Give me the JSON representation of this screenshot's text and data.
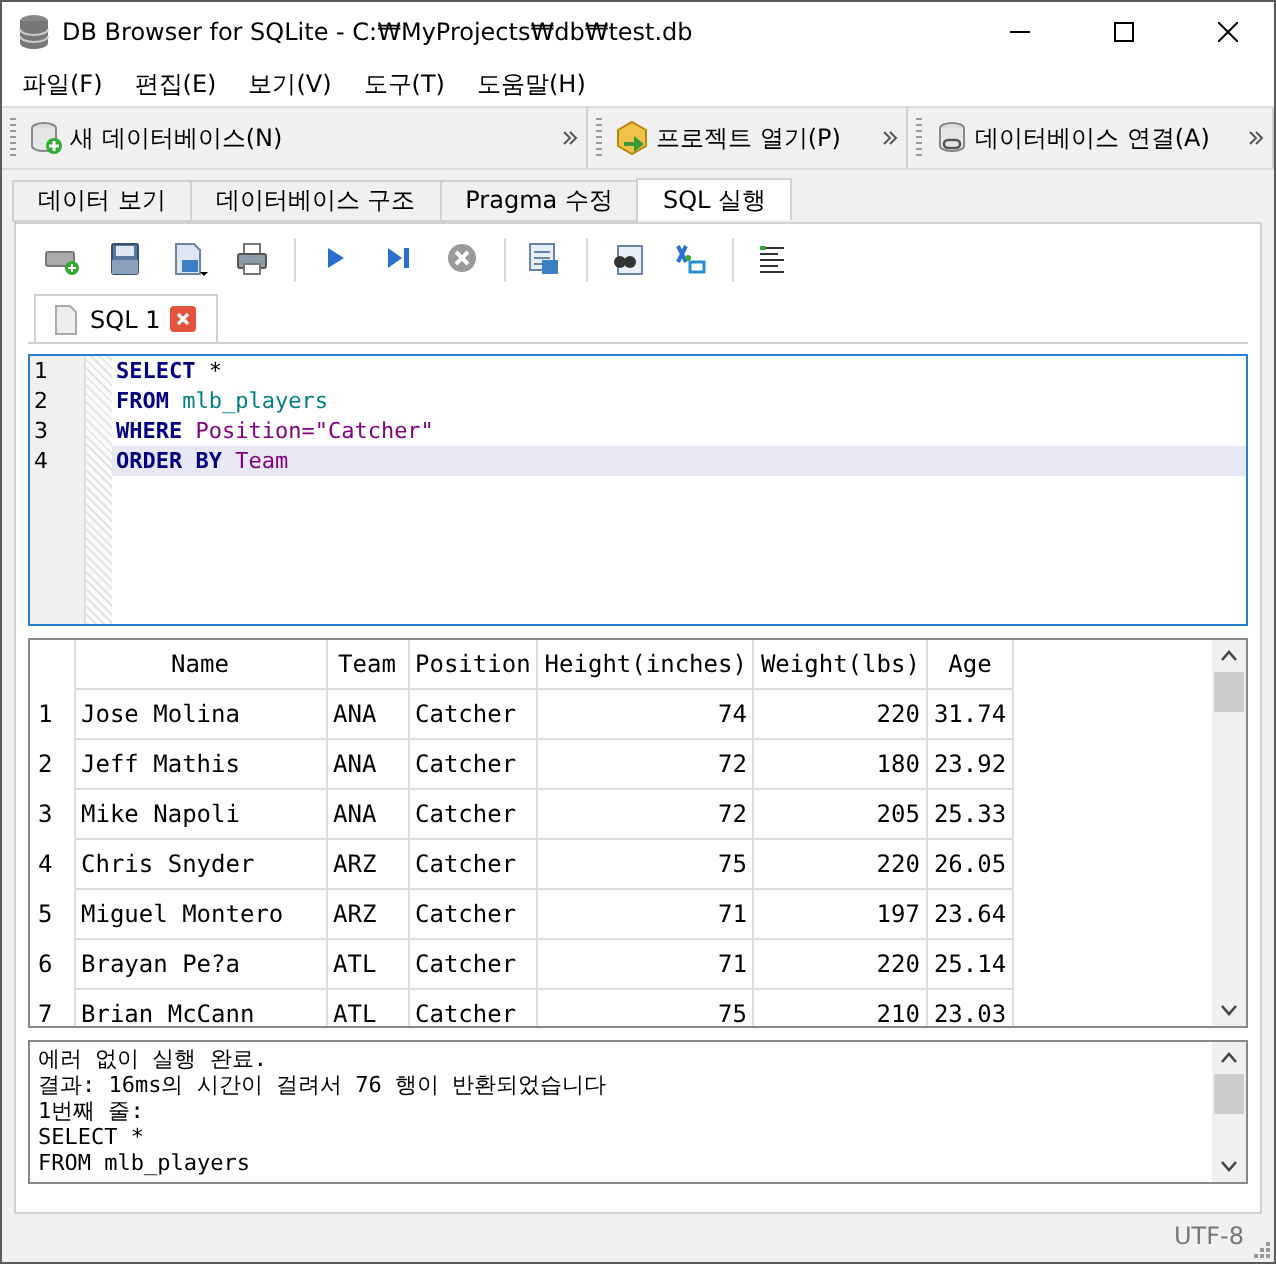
{
  "window": {
    "title": "DB Browser for SQLite - C:₩MyProjects₩db₩test.db"
  },
  "menu": [
    "파일(F)",
    "편집(E)",
    "보기(V)",
    "도구(T)",
    "도움말(H)"
  ],
  "toolbar": [
    {
      "kind": "new",
      "label": "새 데이터베이스(N)"
    },
    {
      "kind": "open",
      "label": "프로젝트 열기(P)"
    },
    {
      "kind": "attach",
      "label": "데이터베이스 연결(A)"
    }
  ],
  "tabs": [
    {
      "label": "데이터 보기",
      "selected": false
    },
    {
      "label": "데이터베이스 구조",
      "selected": false
    },
    {
      "label": "Pragma 수정",
      "selected": false
    },
    {
      "label": "SQL 실행",
      "selected": true
    }
  ],
  "editor_tabs": [
    {
      "label": "SQL 1",
      "selected": true
    }
  ],
  "editor": {
    "lines": [
      {
        "number": "1",
        "current": false,
        "tokens": [
          {
            "kind": "keyword",
            "text": "SELECT"
          },
          {
            "kind": "plain",
            "text": "*"
          }
        ]
      },
      {
        "number": "2",
        "current": false,
        "tokens": [
          {
            "kind": "keyword",
            "text": "FROM"
          },
          {
            "kind": "table",
            "text": "mlb_players"
          }
        ]
      },
      {
        "number": "3",
        "current": false,
        "tokens": [
          {
            "kind": "keyword",
            "text": "WHERE"
          },
          {
            "kind": "column",
            "text": "Position="
          },
          {
            "kind": "string",
            "text": "\"Catcher\""
          }
        ]
      },
      {
        "number": "4",
        "current": true,
        "tokens": [
          {
            "kind": "keyword",
            "text": "ORDER BY"
          },
          {
            "kind": "column",
            "text": "Team"
          }
        ]
      }
    ]
  },
  "table": {
    "columns": [
      "Name",
      "Team",
      "Position",
      "Height(inches)",
      "Weight(lbs)",
      "Age"
    ],
    "rows": [
      {
        "number": "1",
        "cells": [
          "Jose Molina",
          "ANA",
          "Catcher",
          "74",
          "220",
          "31.74"
        ]
      },
      {
        "number": "2",
        "cells": [
          "Jeff Mathis",
          "ANA",
          "Catcher",
          "72",
          "180",
          "23.92"
        ]
      },
      {
        "number": "3",
        "cells": [
          "Mike Napoli",
          "ANA",
          "Catcher",
          "72",
          "205",
          "25.33"
        ]
      },
      {
        "number": "4",
        "cells": [
          "Chris Snyder",
          "ARZ",
          "Catcher",
          "75",
          "220",
          "26.05"
        ]
      },
      {
        "number": "5",
        "cells": [
          "Miguel Montero",
          "ARZ",
          "Catcher",
          "71",
          "197",
          "23.64"
        ]
      },
      {
        "number": "6",
        "cells": [
          "Brayan Pe?a",
          "ATL",
          "Catcher",
          "71",
          "220",
          "25.14"
        ]
      },
      {
        "number": "7",
        "cells": [
          "Brian McCann",
          "ATL",
          "Catcher",
          "75",
          "210",
          "23.03"
        ]
      }
    ]
  },
  "messages": [
    "에러 없이 실행 완료.",
    "결과: 16ms의 시간이 걸려서 76 행이 반환되었습니다",
    "1번째 줄:",
    "SELECT *",
    "FROM mlb_players"
  ],
  "status_bar": {
    "encoding": "UTF-8"
  }
}
